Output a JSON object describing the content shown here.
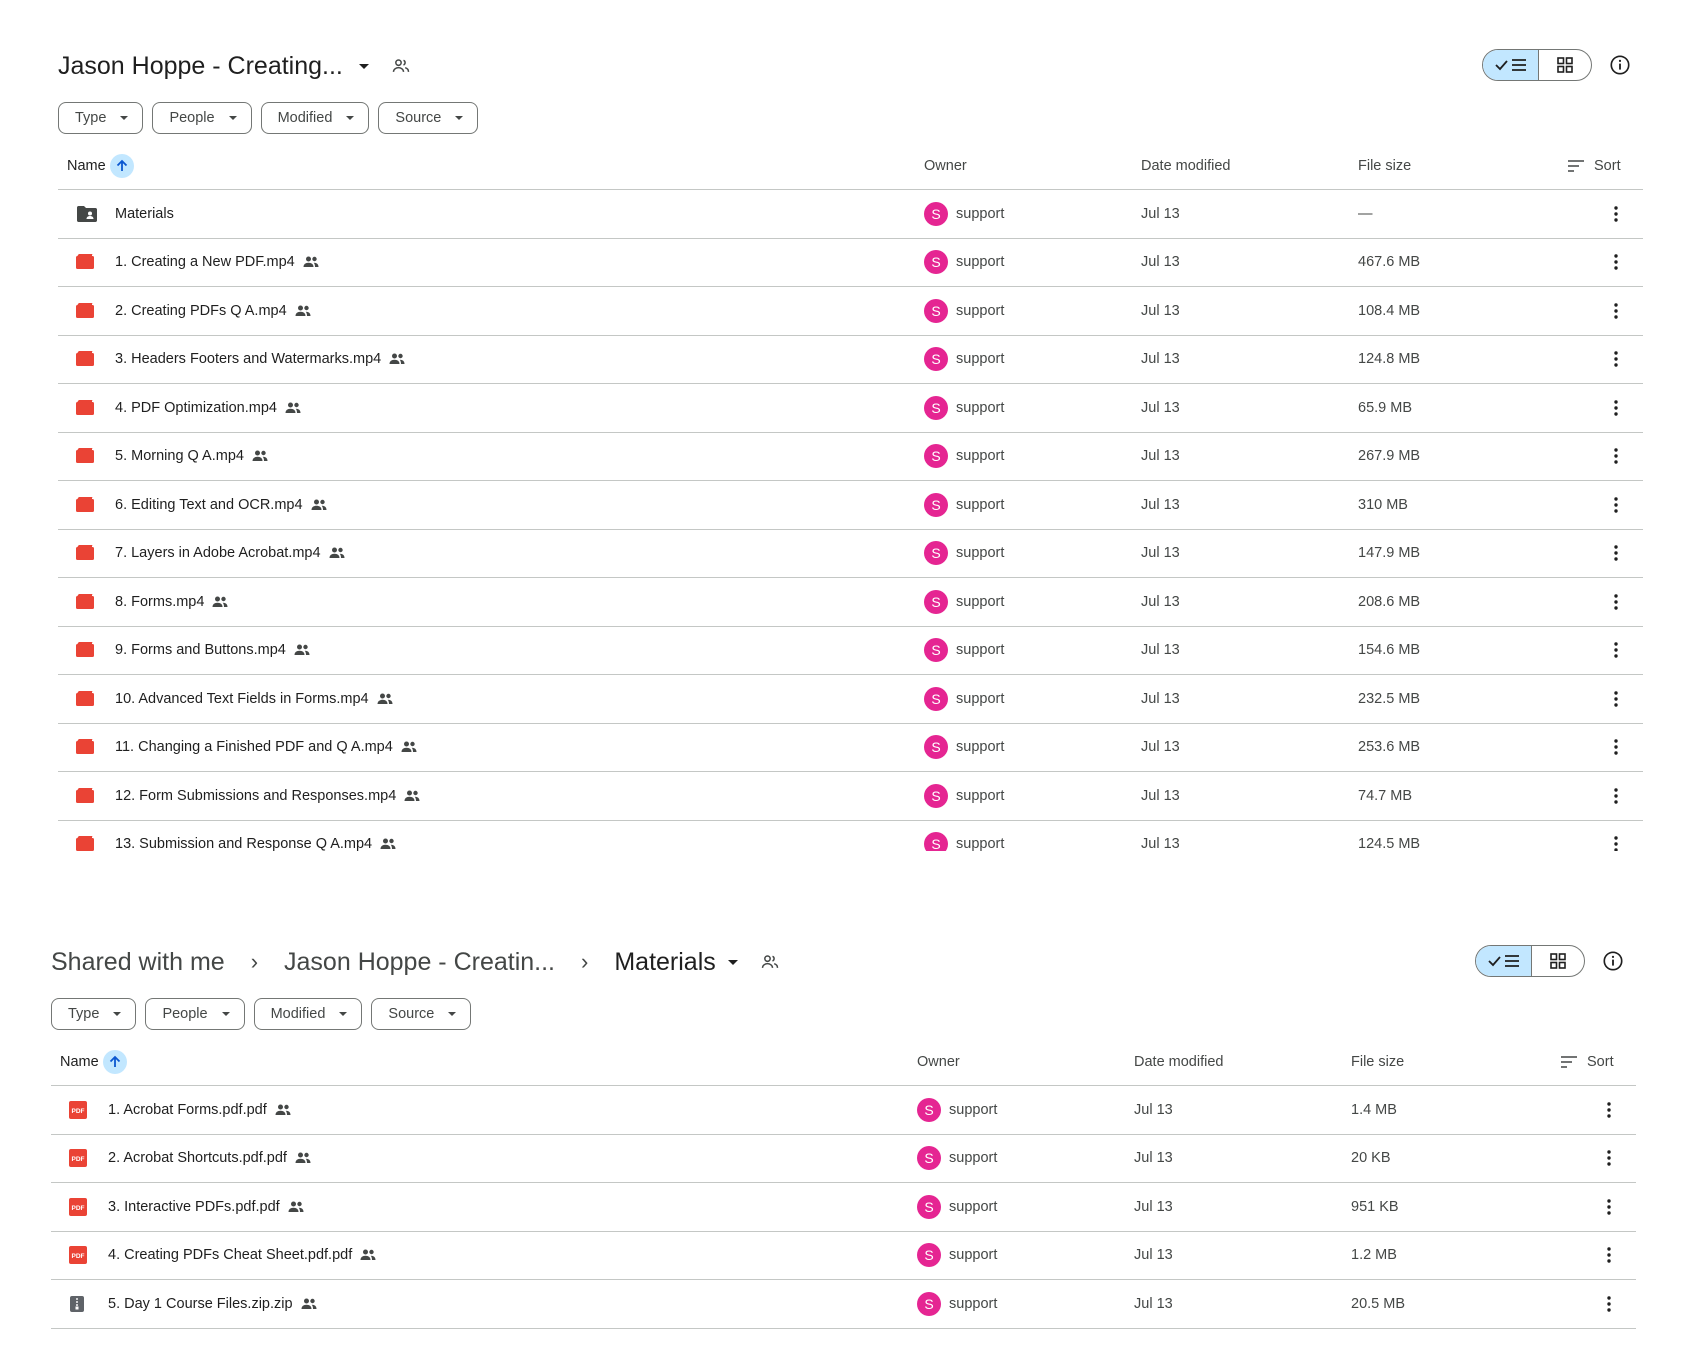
{
  "panel1": {
    "title": "Jason Hoppe - Creating...",
    "filters": [
      "Type",
      "People",
      "Modified",
      "Source"
    ],
    "columns": {
      "name": "Name",
      "owner": "Owner",
      "date": "Date modified",
      "size": "File size",
      "sort": "Sort"
    },
    "rows": [
      {
        "name": "Materials",
        "type": "folder",
        "owner": "support",
        "avatar": "S",
        "date": "Jul 13",
        "size": "—",
        "shared": false
      },
      {
        "name": "1. Creating a New PDF.mp4",
        "type": "video",
        "owner": "support",
        "avatar": "S",
        "date": "Jul 13",
        "size": "467.6 MB",
        "shared": true
      },
      {
        "name": "2. Creating PDFs Q A.mp4",
        "type": "video",
        "owner": "support",
        "avatar": "S",
        "date": "Jul 13",
        "size": "108.4 MB",
        "shared": true
      },
      {
        "name": "3. Headers Footers and Watermarks.mp4",
        "type": "video",
        "owner": "support",
        "avatar": "S",
        "date": "Jul 13",
        "size": "124.8 MB",
        "shared": true
      },
      {
        "name": "4. PDF Optimization.mp4",
        "type": "video",
        "owner": "support",
        "avatar": "S",
        "date": "Jul 13",
        "size": "65.9 MB",
        "shared": true
      },
      {
        "name": "5. Morning Q A.mp4",
        "type": "video",
        "owner": "support",
        "avatar": "S",
        "date": "Jul 13",
        "size": "267.9 MB",
        "shared": true
      },
      {
        "name": "6. Editing Text and OCR.mp4",
        "type": "video",
        "owner": "support",
        "avatar": "S",
        "date": "Jul 13",
        "size": "310 MB",
        "shared": true
      },
      {
        "name": "7. Layers in Adobe Acrobat.mp4",
        "type": "video",
        "owner": "support",
        "avatar": "S",
        "date": "Jul 13",
        "size": "147.9 MB",
        "shared": true
      },
      {
        "name": "8. Forms.mp4",
        "type": "video",
        "owner": "support",
        "avatar": "S",
        "date": "Jul 13",
        "size": "208.6 MB",
        "shared": true
      },
      {
        "name": "9. Forms and Buttons.mp4",
        "type": "video",
        "owner": "support",
        "avatar": "S",
        "date": "Jul 13",
        "size": "154.6 MB",
        "shared": true
      },
      {
        "name": "10. Advanced Text Fields in Forms.mp4",
        "type": "video",
        "owner": "support",
        "avatar": "S",
        "date": "Jul 13",
        "size": "232.5 MB",
        "shared": true
      },
      {
        "name": "11. Changing a Finished PDF and Q A.mp4",
        "type": "video",
        "owner": "support",
        "avatar": "S",
        "date": "Jul 13",
        "size": "253.6 MB",
        "shared": true
      },
      {
        "name": "12. Form Submissions and Responses.mp4",
        "type": "video",
        "owner": "support",
        "avatar": "S",
        "date": "Jul 13",
        "size": "74.7 MB",
        "shared": true
      },
      {
        "name": "13. Submission and Response Q A.mp4",
        "type": "video",
        "owner": "support",
        "avatar": "S",
        "date": "Jul 13",
        "size": "124.5 MB",
        "shared": true
      }
    ]
  },
  "panel2": {
    "breadcrumb": [
      "Shared with me",
      "Jason Hoppe - Creatin...",
      "Materials"
    ],
    "filters": [
      "Type",
      "People",
      "Modified",
      "Source"
    ],
    "columns": {
      "name": "Name",
      "owner": "Owner",
      "date": "Date modified",
      "size": "File size",
      "sort": "Sort"
    },
    "rows": [
      {
        "name": "1. Acrobat Forms.pdf.pdf",
        "type": "pdf",
        "owner": "support",
        "avatar": "S",
        "date": "Jul 13",
        "size": "1.4 MB",
        "shared": true
      },
      {
        "name": "2. Acrobat Shortcuts.pdf.pdf",
        "type": "pdf",
        "owner": "support",
        "avatar": "S",
        "date": "Jul 13",
        "size": "20 KB",
        "shared": true
      },
      {
        "name": "3. Interactive PDFs.pdf.pdf",
        "type": "pdf",
        "owner": "support",
        "avatar": "S",
        "date": "Jul 13",
        "size": "951 KB",
        "shared": true
      },
      {
        "name": "4. Creating PDFs Cheat Sheet.pdf.pdf",
        "type": "pdf",
        "owner": "support",
        "avatar": "S",
        "date": "Jul 13",
        "size": "1.2 MB",
        "shared": true
      },
      {
        "name": "5. Day 1 Course Files.zip.zip",
        "type": "zip",
        "owner": "support",
        "avatar": "S",
        "date": "Jul 13",
        "size": "20.5 MB",
        "shared": true
      }
    ]
  },
  "colors": {
    "accent": "#c2e7ff",
    "avatar": "#e52592",
    "video": "#ea4335",
    "pdf": "#ea4335",
    "zip": "#5f6368"
  },
  "icons": {
    "folder": "shared-folder-icon",
    "video": "video-file-icon",
    "pdf": "pdf-file-icon",
    "zip": "zip-file-icon",
    "shared": "people-icon",
    "more": "more-vert-icon"
  }
}
